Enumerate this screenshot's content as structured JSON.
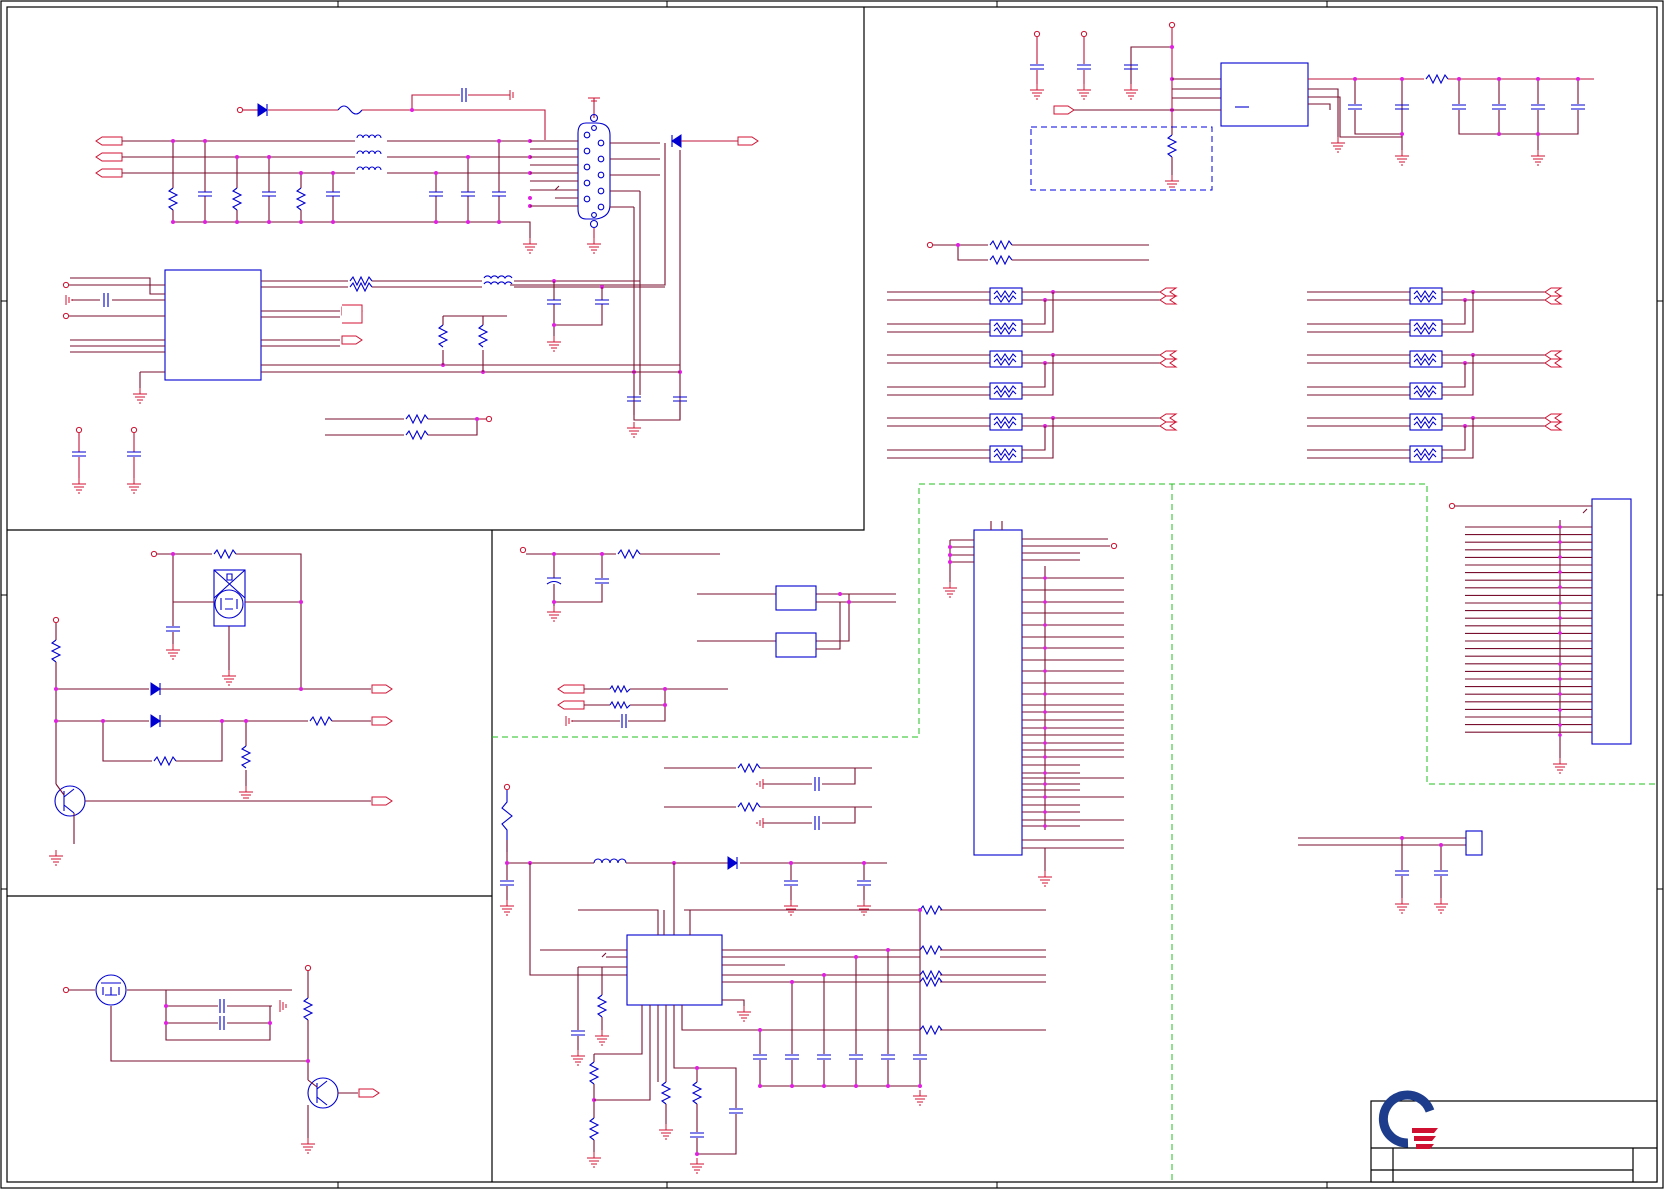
{
  "sheet": {
    "logo": {
      "icon": "company-logo-icon",
      "ring_color": "#1e3c8c",
      "stripe_color": "#d01030"
    }
  },
  "colors": {
    "wire": "#7a1030",
    "net": "#c0143c",
    "component": "#0000d0",
    "junction": "#e020e0",
    "keepout_blue": "#0000e0",
    "keepout_green": "#20c020"
  },
  "icons": {
    "connector": "db15-vga-connector-icon",
    "transistor": "bipolar-transistor-icon",
    "mosfet": "mosfet-icon",
    "diode": "diode-icon",
    "ground": "ground-icon",
    "power": "power-flag-icon"
  }
}
